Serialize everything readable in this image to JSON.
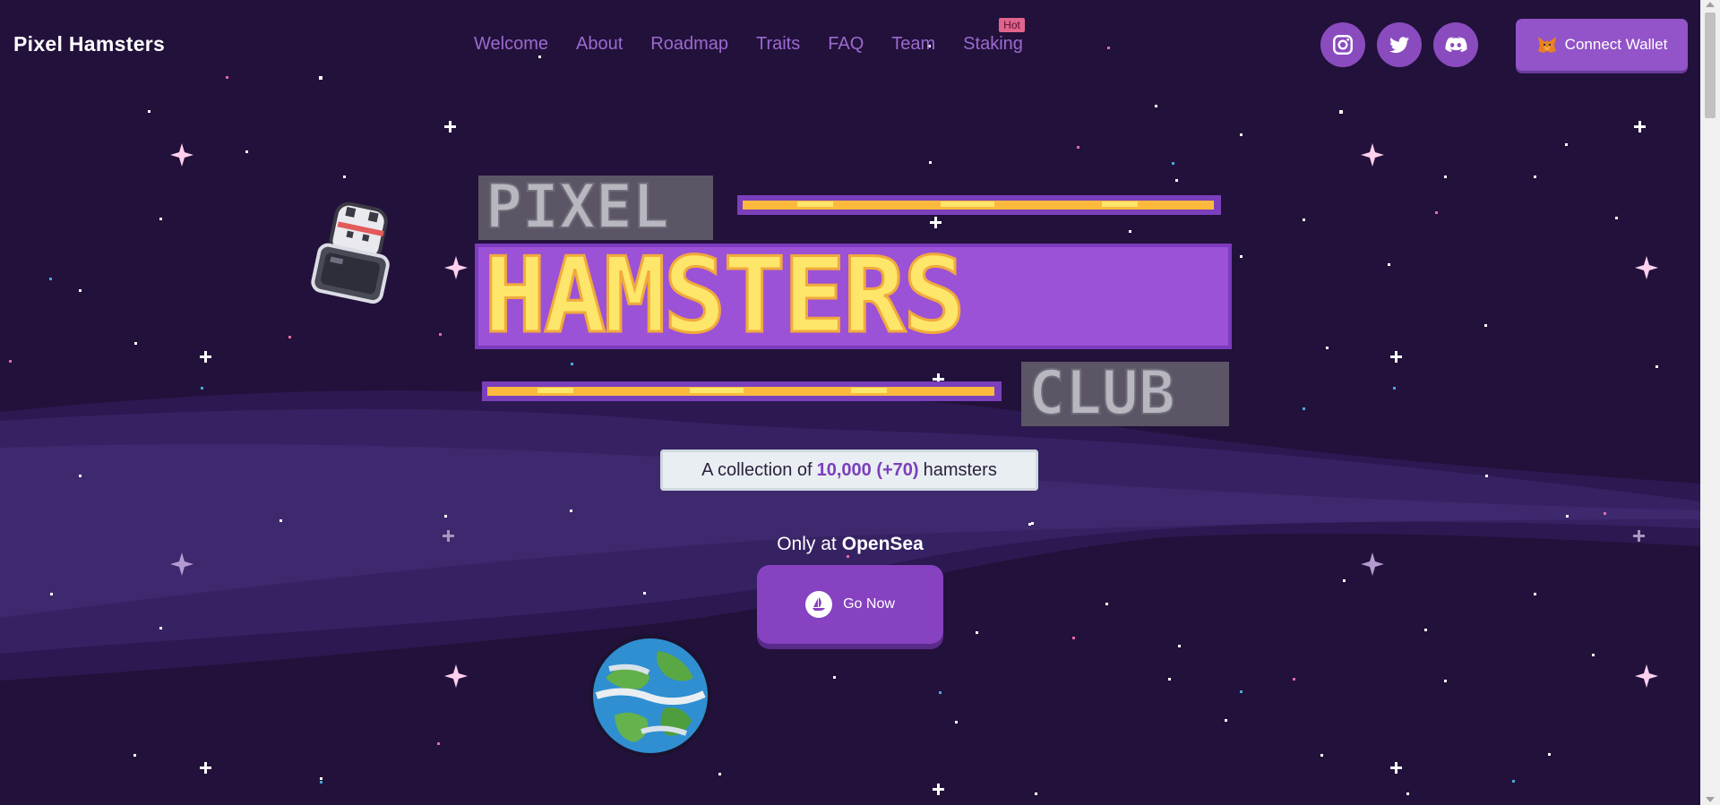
{
  "app": {
    "brand": "Pixel Hamsters"
  },
  "nav": {
    "items": [
      {
        "label": "Welcome"
      },
      {
        "label": "About"
      },
      {
        "label": "Roadmap"
      },
      {
        "label": "Traits"
      },
      {
        "label": "FAQ"
      },
      {
        "label": "Team"
      },
      {
        "label": "Staking",
        "badge": "Hot"
      }
    ]
  },
  "socials": [
    {
      "icon": "instagram-icon"
    },
    {
      "icon": "twitter-icon"
    },
    {
      "icon": "discord-icon"
    }
  ],
  "wallet": {
    "label": "Connect Wallet",
    "icon": "metamask-fox-icon"
  },
  "hero": {
    "logo_lines": [
      "PIXEL",
      "HAMSTERS",
      "CLUB"
    ],
    "subtitle_prefix": "A collection of",
    "subtitle_count": "10,000 (+70)",
    "subtitle_suffix": "hamsters",
    "only_at_prefix": "Only at",
    "only_at_market": "OpenSea",
    "cta_label": "Go Now",
    "cta_icon": "opensea-icon"
  },
  "colors": {
    "background": "#22113a",
    "accent": "#8a4bbf",
    "nav_text": "#9b6ad0",
    "hot_badge": "#e0648c",
    "logo_yellow": "#fde66a",
    "logo_purple": "#7c3bbd"
  }
}
